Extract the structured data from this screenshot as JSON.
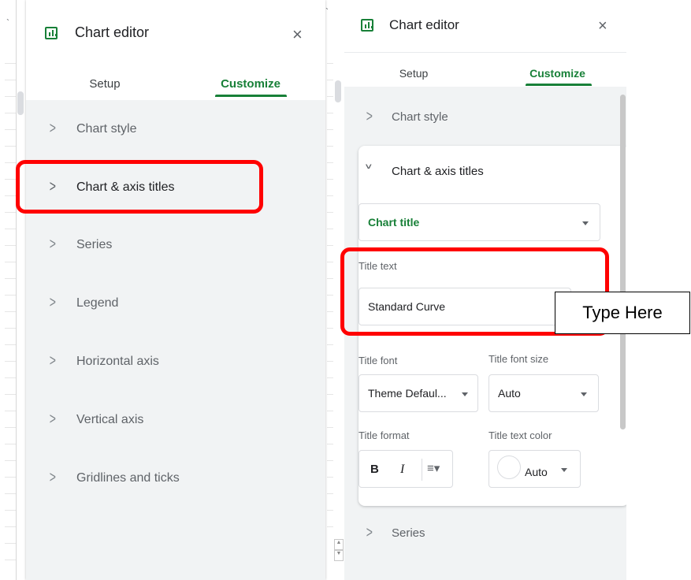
{
  "left_panel": {
    "title": "Chart editor",
    "close_icon": "×",
    "tabs": {
      "setup": "Setup",
      "customize": "Customize"
    },
    "items": [
      {
        "label": "Chart style"
      },
      {
        "label": "Chart & axis titles"
      },
      {
        "label": "Series"
      },
      {
        "label": "Legend"
      },
      {
        "label": "Horizontal axis"
      },
      {
        "label": "Vertical axis"
      },
      {
        "label": "Gridlines and ticks"
      }
    ]
  },
  "right_panel": {
    "title": "Chart editor",
    "close_icon": "×",
    "tabs": {
      "setup": "Setup",
      "customize": "Customize"
    },
    "chart_style": "Chart style",
    "expanded_section": "Chart & axis titles",
    "title_type_select": "Chart title",
    "title_text_label": "Title text",
    "title_text_value": "Standard Curve",
    "title_font_label": "Title font",
    "title_font_value": "Theme Defaul...",
    "title_font_size_label": "Title font size",
    "title_font_size_value": "Auto",
    "title_format_label": "Title format",
    "bold_label": "B",
    "italic_label": "I",
    "title_text_color_label": "Title text color",
    "title_text_color_value": "Auto",
    "series": "Series"
  },
  "callout": {
    "text": "Type Here"
  },
  "icons": {
    "chevron": "chevron-right-icon",
    "chart": "chart-bar-icon",
    "close": "close-icon"
  },
  "colors": {
    "accent": "#188038",
    "highlight": "#ff0000"
  }
}
